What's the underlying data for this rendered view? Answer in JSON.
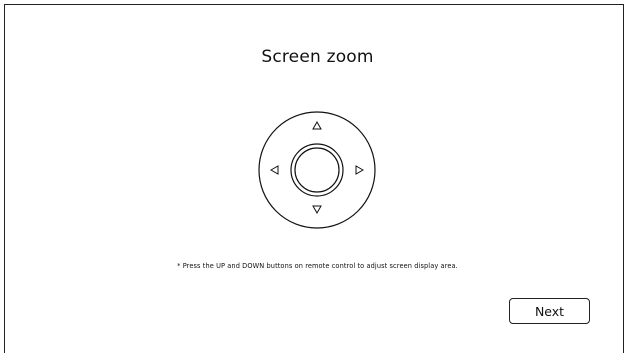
{
  "title": "Screen zoom",
  "remote": {
    "icon": "remote-dpad-icon",
    "buttons": [
      "up-arrow-icon",
      "down-arrow-icon",
      "left-arrow-icon",
      "right-arrow-icon",
      "ok-button"
    ]
  },
  "hint": "* Press the UP and DOWN buttons on remote control to adjust screen display area.",
  "next_label": "Next"
}
